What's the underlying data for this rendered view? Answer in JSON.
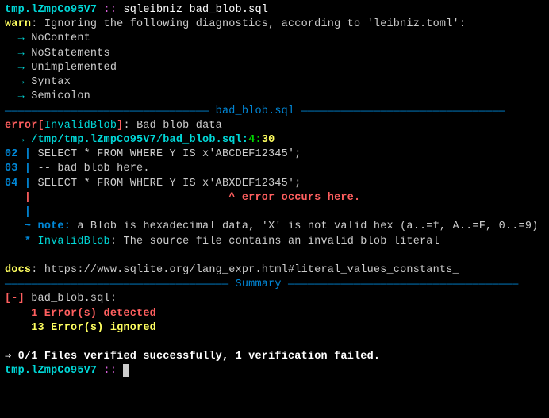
{
  "prompt1": {
    "dir": "tmp.lZmpCo95V7",
    "sep": " :: ",
    "cmd": "sqleibniz ",
    "arg": "bad_blob.sql"
  },
  "warn": {
    "tag": "warn",
    "msg": ": Ignoring the following diagnostics, according to 'leibniz.toml':",
    "arrow": "  → ",
    "items": [
      "NoContent",
      "NoStatements",
      "Unimplemented",
      "Syntax",
      "Semicolon"
    ]
  },
  "rule1": {
    "left": "═══════════════════════════════ ",
    "title": "bad_blob.sql",
    "right": " ═══════════════════════════════"
  },
  "err": {
    "tag": "error",
    "lb": "[",
    "code": "InvalidBlob",
    "rb": "]",
    "msg": ": Bad blob data",
    "arrow": "  → ",
    "path": "/tmp/tmp.lZmpCo95V7/bad_blob.sql",
    "colon1": ":",
    "line": "4",
    "colon2": ":",
    "col": "30"
  },
  "code": {
    "l02n": "02 ",
    "l03n": "03 ",
    "l04n": "04 ",
    "bar": "| ",
    "barOnly": "   |",
    "l02": "SELECT * FROM WHERE Y IS x'ABCDEF12345';",
    "l03": "-- bad blob here.",
    "l04": "SELECT * FROM WHERE Y IS x'ABXDEF12345';",
    "caret": "   |                              ^ error occurs here."
  },
  "note": {
    "prefix": "   ~ ",
    "tag": "note:",
    "msg": " a Blob is hexadecimal data, 'X' is not valid hex (a..=f, A..=F, 0..=9)",
    "star": "   * ",
    "code": "InvalidBlob",
    "msg2": ": The source file contains an invalid blob literal"
  },
  "docs": {
    "tag": "docs",
    "url": ": https://www.sqlite.org/lang_expr.html#literal_values_constants_"
  },
  "rule2": {
    "left": "══════════════════════════════════ ",
    "title": "Summary",
    "right": " ═══════════════════════════════════"
  },
  "summary": {
    "marker": "[-]",
    "file": " bad_blob.sql:",
    "errLine": "    1 Error(s) detected",
    "ignLine": "    13 Error(s) ignored"
  },
  "final": {
    "arrow": "⇒ ",
    "msg": "0/1 Files verified successfully, 1 verification failed."
  },
  "prompt2": {
    "dir": "tmp.lZmpCo95V7",
    "sep": " :: "
  }
}
